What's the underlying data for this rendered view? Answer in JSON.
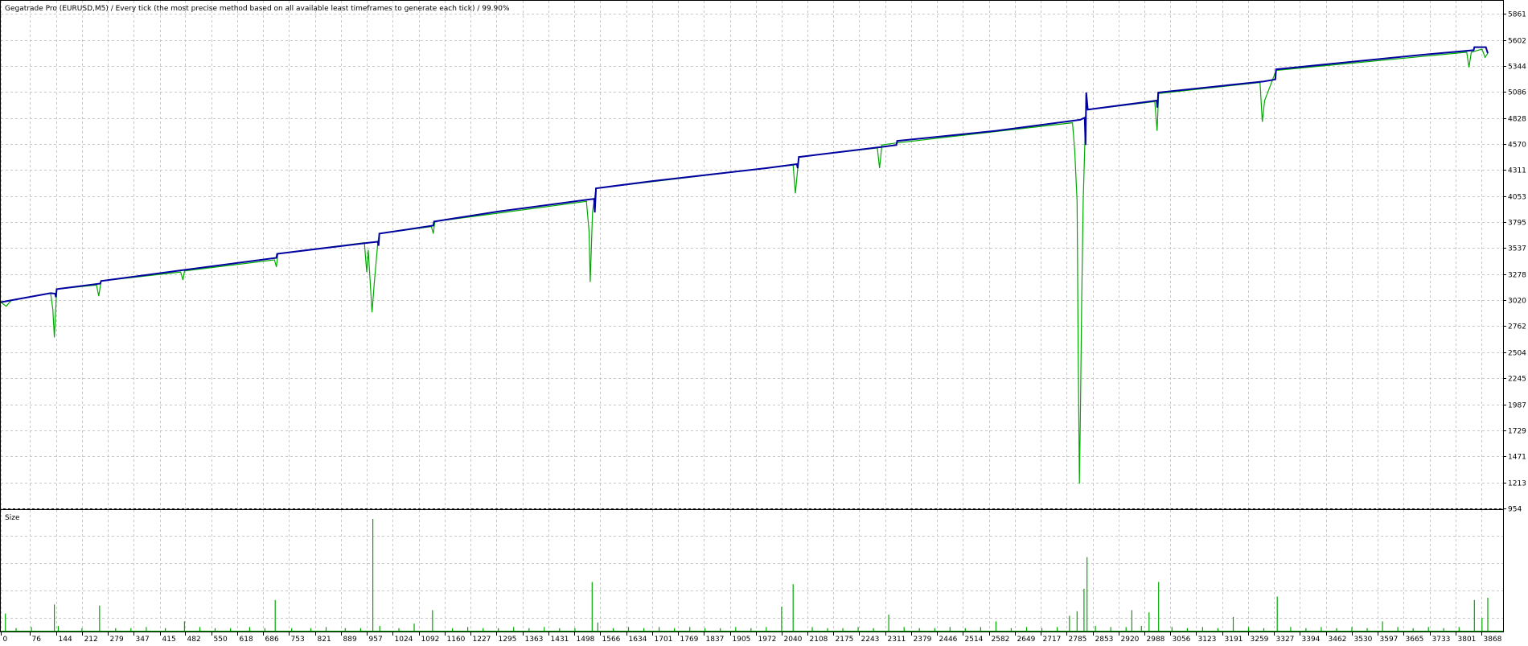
{
  "chart_data": [
    {
      "type": "line",
      "title": "Gegatrade Pro (EURUSD,M5) / Every tick (the most precise method based on all available least timeframes to generate each tick) / 99.90%",
      "xlim": [
        0,
        3925
      ],
      "ylim": [
        954,
        5990
      ],
      "yticks": [
        5861,
        5602,
        5344,
        5086,
        4828,
        4570,
        4311,
        4053,
        3795,
        3537,
        3278,
        3020,
        2762,
        2504,
        2245,
        1987,
        1729,
        1471,
        1213,
        954
      ],
      "xticks": [
        0,
        76,
        144,
        212,
        279,
        347,
        415,
        482,
        550,
        618,
        686,
        753,
        821,
        889,
        957,
        1024,
        1092,
        1160,
        1227,
        1295,
        1363,
        1431,
        1498,
        1566,
        1634,
        1701,
        1769,
        1837,
        1905,
        1972,
        2040,
        2108,
        2175,
        2243,
        2311,
        2379,
        2446,
        2514,
        2582,
        2649,
        2717,
        2785,
        2853,
        2920,
        2988,
        3056,
        3123,
        3191,
        3259,
        3327,
        3394,
        3462,
        3530,
        3597,
        3665,
        3733,
        3801,
        3868
      ],
      "grid": true,
      "series": [
        {
          "color": "#0000a0",
          "points": [
            [
              0,
              3000
            ],
            [
              130,
              3090
            ],
            [
              142,
              3085
            ],
            [
              144,
              3050
            ],
            [
              146,
              3130
            ],
            [
              260,
              3185
            ],
            [
              262,
              3210
            ],
            [
              480,
              3320
            ],
            [
              720,
              3440
            ],
            [
              722,
              3480
            ],
            [
              960,
              3590
            ],
            [
              985,
              3600
            ],
            [
              987,
              3560
            ],
            [
              989,
              3680
            ],
            [
              1130,
              3760
            ],
            [
              1132,
              3800
            ],
            [
              1300,
              3900
            ],
            [
              1540,
              4020
            ],
            [
              1550,
              4025
            ],
            [
              1552,
              3890
            ],
            [
              1555,
              4130
            ],
            [
              1700,
              4200
            ],
            [
              2000,
              4330
            ],
            [
              2080,
              4370
            ],
            [
              2082,
              4330
            ],
            [
              2085,
              4440
            ],
            [
              2300,
              4540
            ],
            [
              2340,
              4560
            ],
            [
              2342,
              4600
            ],
            [
              2600,
              4700
            ],
            [
              2820,
              4810
            ],
            [
              2832,
              4830
            ],
            [
              2834,
              4560
            ],
            [
              2836,
              5080
            ],
            [
              2838,
              4990
            ],
            [
              2840,
              4910
            ],
            [
              3020,
              5000
            ],
            [
              3022,
              4930
            ],
            [
              3024,
              5080
            ],
            [
              3300,
              5190
            ],
            [
              3330,
              5210
            ],
            [
              3332,
              5310
            ],
            [
              3700,
              5450
            ],
            [
              3848,
              5500
            ],
            [
              3850,
              5530
            ],
            [
              3880,
              5530
            ],
            [
              3885,
              5470
            ]
          ]
        },
        {
          "color": "#00aa00",
          "points": [
            [
              0,
              3000
            ],
            [
              14,
              2960
            ],
            [
              28,
              3020
            ],
            [
              130,
              3090
            ],
            [
              136,
              2930
            ],
            [
              140,
              2650
            ],
            [
              146,
              3130
            ],
            [
              250,
              3170
            ],
            [
              256,
              3060
            ],
            [
              262,
              3210
            ],
            [
              470,
              3300
            ],
            [
              476,
              3220
            ],
            [
              480,
              3310
            ],
            [
              715,
              3420
            ],
            [
              720,
              3350
            ],
            [
              724,
              3480
            ],
            [
              950,
              3590
            ],
            [
              956,
              3300
            ],
            [
              960,
              3520
            ],
            [
              970,
              2900
            ],
            [
              976,
              3200
            ],
            [
              985,
              3590
            ],
            [
              989,
              3680
            ],
            [
              1125,
              3750
            ],
            [
              1130,
              3680
            ],
            [
              1134,
              3800
            ],
            [
              1530,
              4000
            ],
            [
              1537,
              3700
            ],
            [
              1540,
              3200
            ],
            [
              1546,
              3900
            ],
            [
              1555,
              4130
            ],
            [
              2070,
              4360
            ],
            [
              2076,
              4080
            ],
            [
              2085,
              4440
            ],
            [
              2290,
              4530
            ],
            [
              2296,
              4330
            ],
            [
              2302,
              4560
            ],
            [
              2340,
              4580
            ],
            [
              2800,
              4780
            ],
            [
              2806,
              4500
            ],
            [
              2812,
              4000
            ],
            [
              2815,
              2500
            ],
            [
              2818,
              1200
            ],
            [
              2821,
              2000
            ],
            [
              2824,
              3000
            ],
            [
              2828,
              4000
            ],
            [
              2836,
              5060
            ],
            [
              2840,
              4910
            ],
            [
              3015,
              4990
            ],
            [
              3021,
              4700
            ],
            [
              3025,
              5070
            ],
            [
              3290,
              5180
            ],
            [
              3296,
              4790
            ],
            [
              3302,
              5000
            ],
            [
              3332,
              5300
            ],
            [
              3830,
              5480
            ],
            [
              3836,
              5330
            ],
            [
              3842,
              5480
            ],
            [
              3870,
              5510
            ],
            [
              3878,
              5430
            ],
            [
              3885,
              5470
            ]
          ]
        }
      ]
    },
    {
      "type": "bar",
      "title": "Size",
      "xlim": [
        0,
        3925
      ],
      "ymax": 100,
      "spikes": [
        [
          12,
          16
        ],
        [
          40,
          3
        ],
        [
          80,
          4
        ],
        [
          140,
          24
        ],
        [
          150,
          5
        ],
        [
          212,
          3
        ],
        [
          258,
          23
        ],
        [
          300,
          3
        ],
        [
          340,
          3
        ],
        [
          380,
          4
        ],
        [
          430,
          3
        ],
        [
          480,
          9
        ],
        [
          520,
          4
        ],
        [
          560,
          3
        ],
        [
          600,
          3
        ],
        [
          650,
          4
        ],
        [
          690,
          3
        ],
        [
          717,
          28
        ],
        [
          760,
          3
        ],
        [
          810,
          3
        ],
        [
          850,
          4
        ],
        [
          900,
          3
        ],
        [
          940,
          3
        ],
        [
          972,
          100
        ],
        [
          990,
          5
        ],
        [
          1040,
          3
        ],
        [
          1080,
          7
        ],
        [
          1128,
          19
        ],
        [
          1180,
          3
        ],
        [
          1220,
          4
        ],
        [
          1260,
          3
        ],
        [
          1300,
          3
        ],
        [
          1340,
          4
        ],
        [
          1380,
          3
        ],
        [
          1420,
          4
        ],
        [
          1460,
          3
        ],
        [
          1500,
          3
        ],
        [
          1545,
          44
        ],
        [
          1560,
          8
        ],
        [
          1600,
          3
        ],
        [
          1640,
          4
        ],
        [
          1680,
          3
        ],
        [
          1720,
          4
        ],
        [
          1760,
          3
        ],
        [
          1800,
          4
        ],
        [
          1840,
          3
        ],
        [
          1880,
          3
        ],
        [
          1920,
          4
        ],
        [
          1960,
          3
        ],
        [
          2000,
          4
        ],
        [
          2040,
          22
        ],
        [
          2070,
          42
        ],
        [
          2120,
          4
        ],
        [
          2160,
          3
        ],
        [
          2200,
          3
        ],
        [
          2240,
          4
        ],
        [
          2280,
          3
        ],
        [
          2320,
          15
        ],
        [
          2360,
          4
        ],
        [
          2400,
          3
        ],
        [
          2440,
          3
        ],
        [
          2480,
          4
        ],
        [
          2520,
          3
        ],
        [
          2560,
          4
        ],
        [
          2600,
          9
        ],
        [
          2640,
          3
        ],
        [
          2680,
          4
        ],
        [
          2720,
          3
        ],
        [
          2760,
          4
        ],
        [
          2792,
          14
        ],
        [
          2812,
          18
        ],
        [
          2830,
          38
        ],
        [
          2838,
          66
        ],
        [
          2860,
          5
        ],
        [
          2900,
          4
        ],
        [
          2940,
          4
        ],
        [
          2955,
          19
        ],
        [
          2980,
          5
        ],
        [
          3000,
          17
        ],
        [
          3025,
          44
        ],
        [
          3060,
          4
        ],
        [
          3100,
          3
        ],
        [
          3140,
          4
        ],
        [
          3180,
          3
        ],
        [
          3220,
          13
        ],
        [
          3260,
          4
        ],
        [
          3300,
          3
        ],
        [
          3335,
          31
        ],
        [
          3370,
          4
        ],
        [
          3410,
          3
        ],
        [
          3450,
          4
        ],
        [
          3490,
          3
        ],
        [
          3530,
          4
        ],
        [
          3570,
          3
        ],
        [
          3610,
          9
        ],
        [
          3650,
          4
        ],
        [
          3690,
          3
        ],
        [
          3730,
          4
        ],
        [
          3770,
          3
        ],
        [
          3810,
          4
        ],
        [
          3850,
          28
        ],
        [
          3870,
          12
        ],
        [
          3885,
          30
        ]
      ]
    }
  ]
}
